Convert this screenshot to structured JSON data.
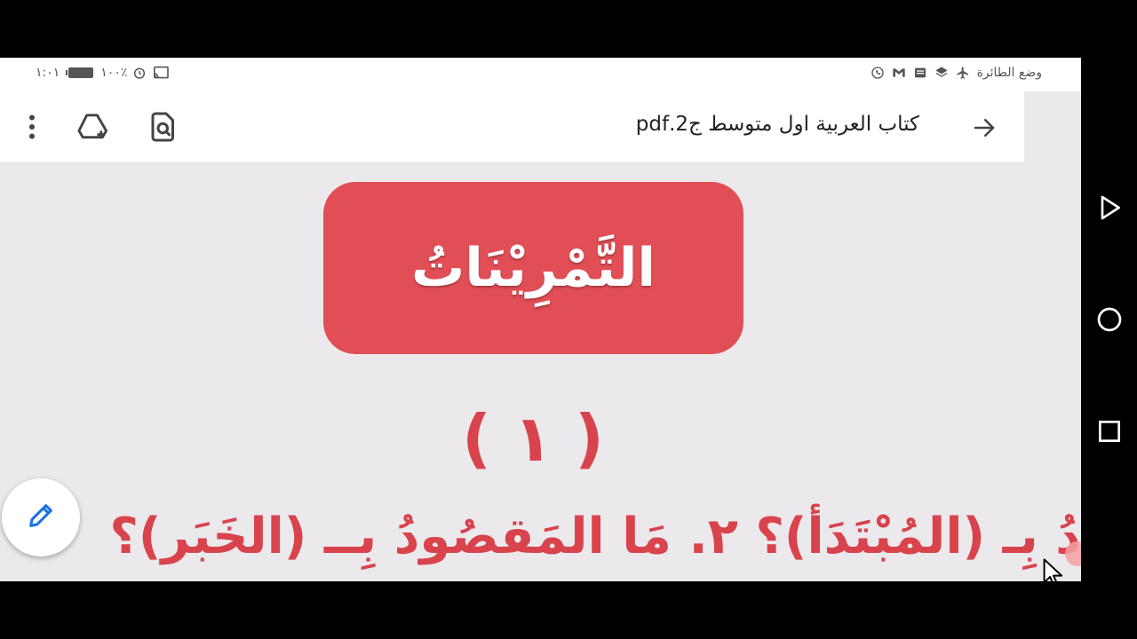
{
  "status_bar": {
    "airplane_mode_label": "وضع الطائرة",
    "time": "١:٠١",
    "battery_percent": "١٠٠٪",
    "icons": [
      "airplane-icon",
      "layers-icon",
      "news-icon",
      "gmail-icon",
      "viber-icon",
      "alarm-icon",
      "cast-icon",
      "battery-icon"
    ]
  },
  "toolbar": {
    "title": "كتاب العربية اول متوسط ج2.pdf",
    "icons": [
      "back-arrow-icon",
      "find-in-page-icon",
      "add-to-drive-icon",
      "more-vert-icon"
    ]
  },
  "page": {
    "banner_text": "التَّمْرِيْنَاتُ",
    "exercise_number": "( ١ )",
    "question_text": "دُ بِـ (المُبْتَدَأ)؟   ٢. مَا المَقصُودُ بِــ (الخَبَر)؟"
  },
  "fab": {
    "icon": "pencil-icon"
  },
  "colors": {
    "banner": "#e14e55",
    "heading_text": "#d9434b",
    "page_bg": "#ebe9ec",
    "fab_icon": "#1a73e8"
  },
  "nav_bar": {
    "icons": [
      "back-triangle-icon",
      "home-circle-icon",
      "recents-square-icon"
    ]
  }
}
